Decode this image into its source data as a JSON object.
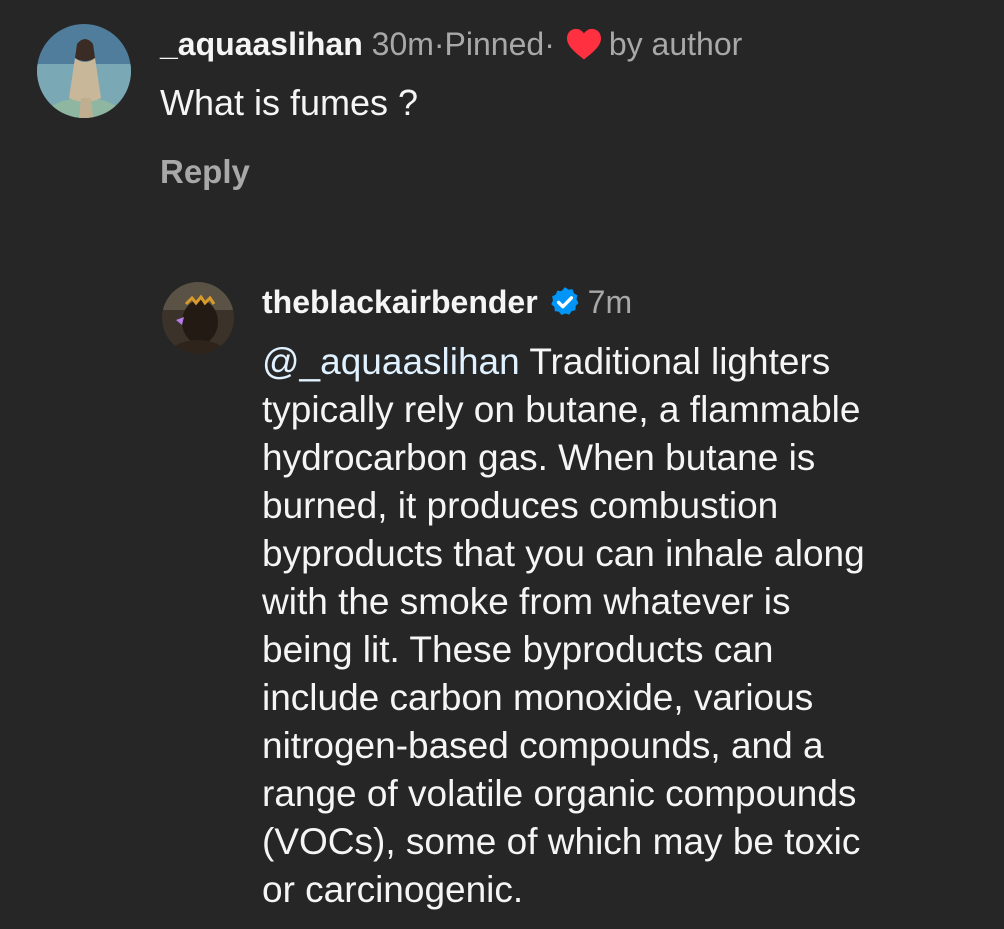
{
  "comments": [
    {
      "username": "_aquaaslihan",
      "time": "30m",
      "separator": " · ",
      "pinned": "Pinned",
      "liked_by_label": "by author",
      "text": "What is fumes ?",
      "reply_label": "Reply",
      "icons": {
        "avatar": "user-avatar",
        "heart": "heart-icon"
      },
      "colors": {
        "heart": "#ff3040"
      }
    },
    {
      "username": "theblackairbender",
      "time": "7m",
      "mention": "@_aquaaslihan",
      "lines": [
        "Traditional lighters",
        "typically rely on butane, a flammable",
        "hydrocarbon gas. When butane is",
        "burned, it produces combustion",
        "byproducts that you can inhale along",
        "with the smoke from whatever is",
        "being lit. These byproducts can",
        "include carbon monoxide, various",
        "nitrogen-based compounds, and a",
        "range of volatile organic compounds",
        "(VOCs), some of which may be toxic",
        "or carcinogenic."
      ],
      "icons": {
        "avatar": "user-avatar",
        "verified": "verified-badge-icon"
      },
      "colors": {
        "verified": "#0095f6",
        "mention": "#e0f1ff"
      }
    }
  ],
  "theme": {
    "background": "#262626",
    "text": "#f5f5f5",
    "muted": "#a8a8a8"
  }
}
